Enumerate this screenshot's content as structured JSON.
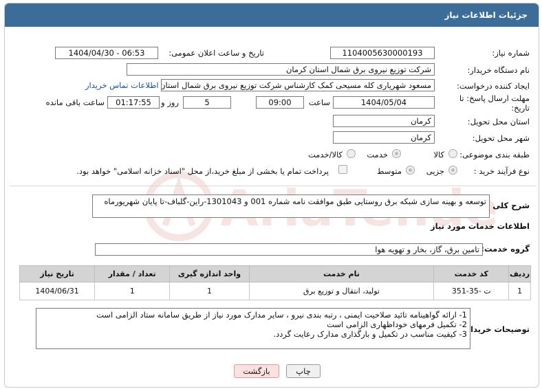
{
  "header": {
    "title": "جزئیات اطلاعات نیاز"
  },
  "fields": {
    "need_number_label": "شماره نیاز:",
    "need_number": "1104005630000193",
    "announce_label": "تاریخ و ساعت اعلان عمومی:",
    "announce_value": "1404/04/30 - 06:53",
    "buyer_label": "نام دستگاه خریدار:",
    "buyer_value": "شرکت توزیع نیروی برق شمال استان کرمان",
    "creator_label": "ایجاد کننده درخواست:",
    "creator_value": "مسعود شهریاری کله مسیحی کمک کارشناس شرکت توزیع نیروی برق شمال استان کرمان",
    "contact_link": "اطلاعات تماس خریدار",
    "deadline_label": "مهلت ارسال پاسخ: تا تاریخ:",
    "deadline_date": "1404/05/04",
    "time_label": "ساعت",
    "deadline_time": "09:00",
    "days_value": "5",
    "days_label": "روز و",
    "remaining_time": "01:17:55",
    "remaining_label": "ساعت باقی مانده",
    "province_label": "استان محل تحویل:",
    "province_value": "کرمان",
    "city_label": "شهر محل تحویل:",
    "city_value": "کرمان",
    "category_label": "طبقه بندی موضوعی:",
    "category_options": [
      "کالا",
      "خدمت",
      "کالا/خدمت"
    ],
    "category_selected": "خدمت",
    "process_label": "نوع فرآیند خرید :",
    "process_options": [
      "جزیی",
      "متوسط"
    ],
    "process_selected": "جزیی",
    "payment_note": "پرداخت تمام یا بخشی از مبلغ خرید،از محل \"اسناد خزانه اسلامی\" خواهد بود."
  },
  "description": {
    "label": "شرح کلی نیاز:",
    "text": "توسعه و بهینه سازی شبکه برق روستایی طبق موافقت نامه شماره  001 و 1301043-راین-گلباف-تا پایان شهریورماه"
  },
  "services": {
    "section_title": "اطلاعات خدمات مورد نیاز",
    "group_label": "گروه خدمت:",
    "group_value": "تامین برق، گاز، بخار و تهویه هوا",
    "columns": [
      "ردیف",
      "کد خدمت",
      "نام خدمت",
      "واحد اندازه گیری",
      "تعداد / مقدار",
      "تاریخ نیاز"
    ],
    "rows": [
      [
        "1",
        "ت -35-351",
        "تولید، انتقال و توزیع برق",
        "1",
        "1",
        "1404/06/31"
      ]
    ]
  },
  "buyer_notes": {
    "label": "توضیحات خریدار:",
    "lines": [
      "1- ارائه گواهینامه تائید صلاحیت ایمنی ، رتبه بندی نیرو  ، سایر مدارک مورد نیاز از طریق سامانه ستاد الزامی است",
      "2- تکمیل فرمهای خوداظهاری الزامی است",
      "3- کیفیت مناسب در تکمیل و بارگذاری مدارک رعایت گردد."
    ]
  },
  "buttons": {
    "print": "چاپ",
    "back": "بازگشت"
  },
  "watermark": {
    "text": "AriaTender.neT"
  },
  "colors": {
    "header_bg": "#3c6d99",
    "link": "#1a4fb0",
    "watermark": "#c0392b"
  }
}
